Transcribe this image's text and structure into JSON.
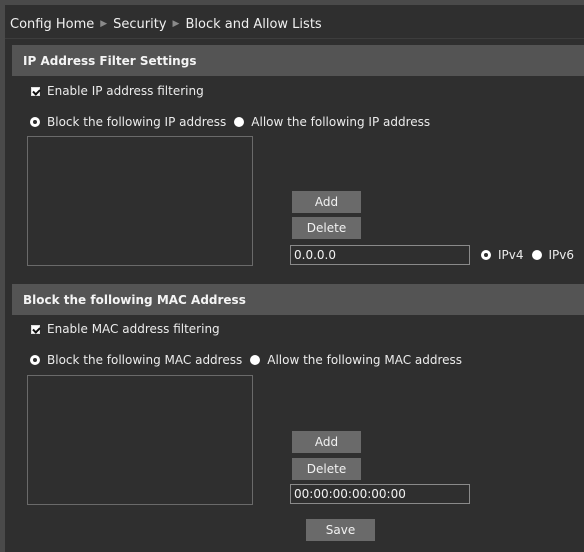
{
  "breadcrumb": {
    "items": [
      "Config Home",
      "Security",
      "Block and Allow Lists"
    ]
  },
  "ip_section": {
    "title": "IP Address Filter Settings",
    "enable_label": "Enable IP address filtering",
    "enable_checked": true,
    "block_label": "Block the following IP address",
    "allow_label": "Allow the following IP address",
    "selected_mode": "block",
    "add_label": "Add",
    "delete_label": "Delete",
    "address_value": "0.0.0.0",
    "ipv4_label": "IPv4",
    "ipv6_label": "IPv6",
    "selected_version": "IPv4"
  },
  "mac_section": {
    "title": "Block the following MAC Address",
    "enable_label": "Enable MAC address filtering",
    "enable_checked": true,
    "block_label": "Block the following MAC address",
    "allow_label": "Allow the following MAC address",
    "selected_mode": "block",
    "add_label": "Add",
    "delete_label": "Delete",
    "address_value": "00:00:00:00:00:00"
  },
  "footer": {
    "save_label": "Save"
  },
  "colors": {
    "background": "#2f2f2f",
    "section_header": "#545454",
    "button": "#6a6a6a"
  }
}
